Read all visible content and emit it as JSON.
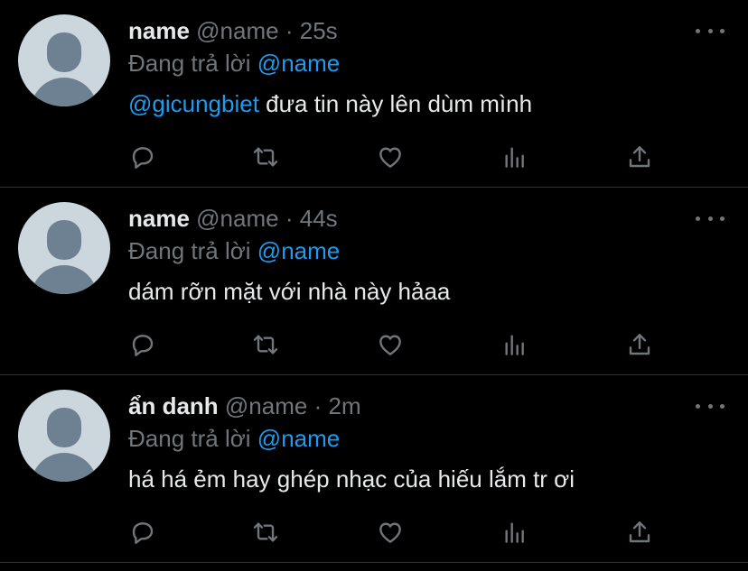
{
  "tweets": [
    {
      "display_name": "name",
      "handle": "@name",
      "separator": "·",
      "time": "25s",
      "reply_prefix": "Đang trả lời",
      "reply_handle": "@name",
      "text_mention": "@gicungbiet",
      "text": " đưa tin này lên dùm mình"
    },
    {
      "display_name": "name",
      "handle": "@name",
      "separator": "·",
      "time": "44s",
      "reply_prefix": "Đang trả lời",
      "reply_handle": "@name",
      "text_mention": "",
      "text": "dám rỡn mặt với nhà này hảaa"
    },
    {
      "display_name": "ẩn danh",
      "handle": "@name",
      "separator": "·",
      "time": "2m",
      "reply_prefix": "Đang trả lời",
      "reply_handle": "@name",
      "text_mention": "",
      "text": "há há ẻm hay ghép nhạc của hiếu lắm tr ơi"
    }
  ],
  "icons": [
    "avatar",
    "more-icon",
    "reply-icon",
    "retweet-icon",
    "like-icon",
    "stats-icon",
    "share-icon"
  ],
  "colors": {
    "background": "#000000",
    "text": "#e7e9ea",
    "muted": "#71767b",
    "accent": "#1d9bf0",
    "divider": "#2f3336",
    "avatar_bg": "#ccd6dd",
    "avatar_fg": "#6e8193"
  }
}
